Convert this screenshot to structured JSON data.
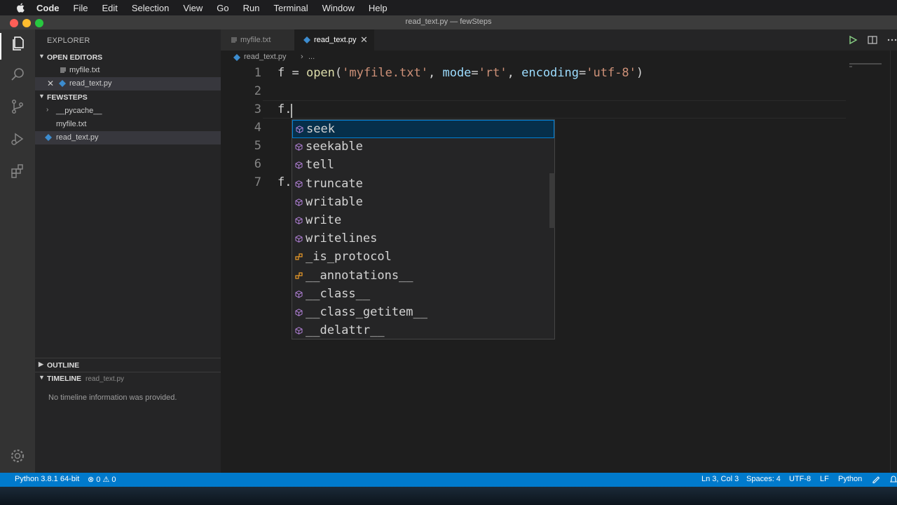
{
  "menubar": {
    "app": "Code",
    "items": [
      "File",
      "Edit",
      "Selection",
      "View",
      "Go",
      "Run",
      "Terminal",
      "Window",
      "Help"
    ]
  },
  "window": {
    "title": "read_text.py — fewSteps"
  },
  "activity_bar": {
    "icons": [
      "files-icon",
      "search-icon",
      "source-control-icon",
      "run-debug-icon",
      "extensions-icon",
      "settings-gear-icon"
    ]
  },
  "sidebar": {
    "title": "EXPLORER",
    "open_editors": {
      "label": "OPEN EDITORS",
      "items": [
        {
          "label": "myfile.txt"
        },
        {
          "label": "read_text.py"
        }
      ]
    },
    "folder": {
      "label": "FEWSTEPS",
      "items": [
        {
          "label": "__pycache__"
        },
        {
          "label": "myfile.txt"
        },
        {
          "label": "read_text.py"
        }
      ]
    },
    "outline": {
      "label": "OUTLINE"
    },
    "timeline": {
      "label": "TIMELINE",
      "file": "read_text.py",
      "empty_message": "No timeline information was provided."
    }
  },
  "tabs": [
    {
      "label": "myfile.txt",
      "active": false
    },
    {
      "label": "read_text.py",
      "active": true
    }
  ],
  "breadcrumb": {
    "file": "read_text.py",
    "separator": "›",
    "more": "..."
  },
  "code": {
    "line_numbers": [
      "1",
      "2",
      "3",
      "4",
      "5",
      "6",
      "7"
    ],
    "line1": {
      "a": "f = ",
      "fn": "open",
      "b": "(",
      "s1": "'myfile.txt'",
      "c": ", ",
      "p1": "mode",
      "d": "=",
      "s2": "'rt'",
      "e": ", ",
      "p2": "encoding",
      "f": "=",
      "s3": "'utf-8'",
      "g": ")"
    },
    "line3": "f.",
    "line7": "f."
  },
  "cursor_position": {
    "line": 3,
    "column": 3
  },
  "suggestions": [
    {
      "label": "seek",
      "kind": "method"
    },
    {
      "label": "seekable",
      "kind": "method"
    },
    {
      "label": "tell",
      "kind": "method"
    },
    {
      "label": "truncate",
      "kind": "method"
    },
    {
      "label": "writable",
      "kind": "method"
    },
    {
      "label": "write",
      "kind": "method"
    },
    {
      "label": "writelines",
      "kind": "method"
    },
    {
      "label": "_is_protocol",
      "kind": "field"
    },
    {
      "label": "__annotations__",
      "kind": "field"
    },
    {
      "label": "__class__",
      "kind": "method"
    },
    {
      "label": "__class_getitem__",
      "kind": "method"
    },
    {
      "label": "__delattr__",
      "kind": "method"
    }
  ],
  "selected_suggestion": "seek",
  "statusbar": {
    "interpreter": "Python 3.8.1 64-bit",
    "errors": "0",
    "warnings": "0",
    "position": "Ln 3, Col 3",
    "spaces": "Spaces: 4",
    "encoding": "UTF-8",
    "eol": "LF",
    "language": "Python"
  },
  "colors": {
    "accent": "#007acc",
    "method_icon": "#b180d7",
    "field_icon": "#ee9d28",
    "string": "#ce9178",
    "function": "#dcdcaa",
    "parameter": "#9cdcfe"
  }
}
